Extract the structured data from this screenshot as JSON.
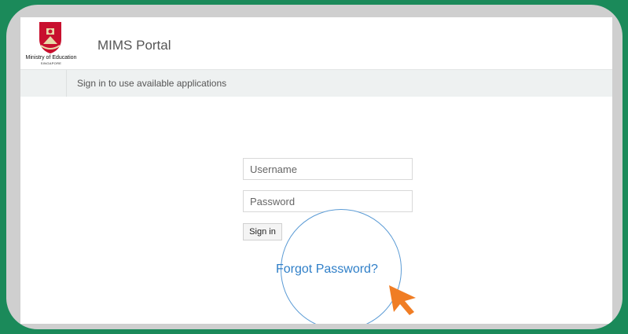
{
  "header": {
    "logo_text": "Ministry of Education",
    "logo_subtext": "SINGAPORE",
    "title": "MIMS Portal"
  },
  "subbar": {
    "text": "Sign in to use available applications"
  },
  "login": {
    "username_placeholder": "Username",
    "password_placeholder": "Password",
    "signin_label": "Sign in",
    "forgot_label": "Forgot Password?"
  },
  "colors": {
    "background": "#1b8a5a",
    "frame": "#cfcfcf",
    "link": "#2f7fc8",
    "cursor": "#f07d24",
    "crest_red": "#c8102e"
  }
}
